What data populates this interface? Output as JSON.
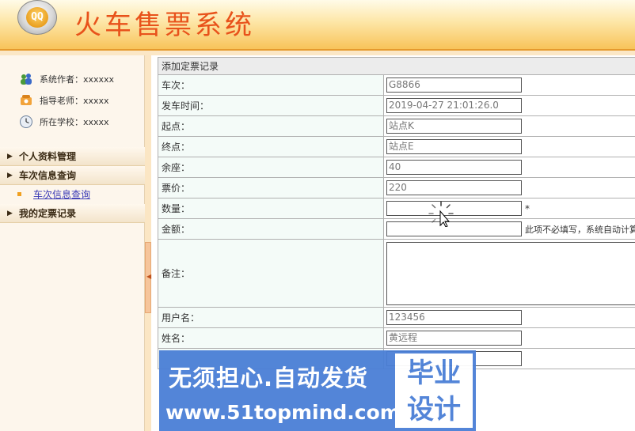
{
  "header": {
    "title": "火车售票系统",
    "logo_text": "QQ"
  },
  "sidebar": {
    "info": [
      {
        "icon": "users-icon",
        "text": "系统作者：xxxxxx"
      },
      {
        "icon": "phone-icon",
        "text": "指导老师：xxxxx"
      },
      {
        "icon": "clock-icon",
        "text": "所在学校：xxxxx"
      }
    ],
    "menu": [
      {
        "label": "个人资料管理"
      },
      {
        "label": "车次信息查询"
      },
      {
        "label": "车次信息查询",
        "sub": true
      },
      {
        "label": "我的定票记录"
      }
    ]
  },
  "form": {
    "title": "添加定票记录",
    "fields": [
      {
        "label": "车次：",
        "value": "G8866"
      },
      {
        "label": "发车时间：",
        "value": "2019-04-27 21:01:26.0"
      },
      {
        "label": "起点：",
        "value": "站点K"
      },
      {
        "label": "终点：",
        "value": "站点E"
      },
      {
        "label": "余座：",
        "value": "40"
      },
      {
        "label": "票价：",
        "value": "220"
      },
      {
        "label": "数量：",
        "value": "",
        "required": "*"
      },
      {
        "label": "金额：",
        "value": "",
        "hint": "此项不必填写，系统自动计算"
      },
      {
        "label": "备注：",
        "value": ""
      },
      {
        "label": "用户名：",
        "value": "123456"
      },
      {
        "label": "姓名：",
        "value": "黄远程"
      },
      {
        "label": "",
        "value": ""
      }
    ]
  },
  "watermark": {
    "line1": "无须担心.自动发货",
    "line2": "www.51topmind.com",
    "badge_line1": "毕业",
    "badge_line2": "设计"
  },
  "colors": {
    "title_orange": "#e8521b",
    "header_gradient_end": "#f8c45a",
    "sidebar_bg": "#fdf6ec",
    "label_cell_bg": "#f4fbf8",
    "watermark_blue": "#4a7fd6",
    "link_blue": "#3b3bb6"
  }
}
